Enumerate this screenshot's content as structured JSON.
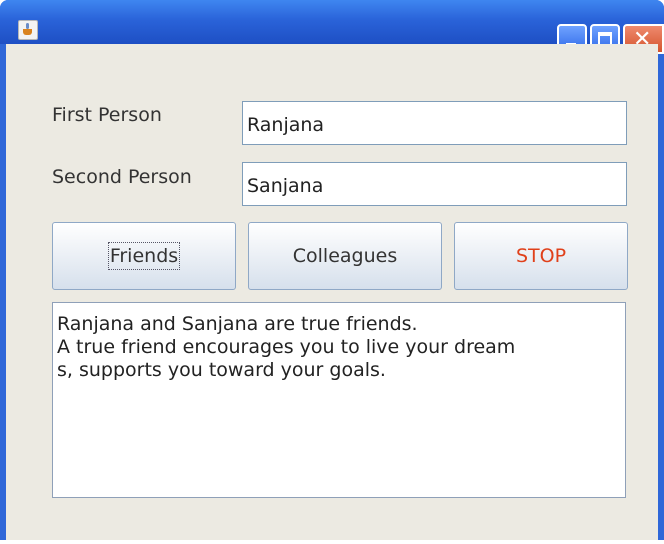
{
  "window": {
    "title": "",
    "controls": {
      "minimize_icon": "minimize-icon",
      "maximize_icon": "maximize-icon",
      "close_icon": "close-icon"
    }
  },
  "form": {
    "first_person_label": "First Person",
    "first_person_value": "Ranjana",
    "second_person_label": "Second Person",
    "second_person_value": "Sanjana"
  },
  "buttons": {
    "friends": "Friends",
    "colleagues": "Colleagues",
    "stop": "STOP",
    "stop_color": "#e0401a"
  },
  "output": {
    "lines": [
      "Ranjana and Sanjana are true friends.",
      "A true friend encourages you to live your dream",
      "s, supports you toward your goals."
    ]
  }
}
